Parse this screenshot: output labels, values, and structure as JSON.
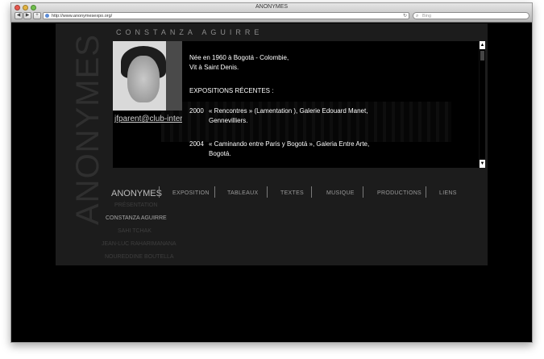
{
  "window": {
    "title": "ANONYMES"
  },
  "browser": {
    "url": "http://www.anonymesexpo.org/",
    "search_placeholder": "Bing",
    "back_label": "◀",
    "forward_label": "▶",
    "add_label": "+"
  },
  "site": {
    "brand": "ANONYMES",
    "vertical_title": "ANONYMES",
    "artist_title": "CONSTANZA AGUIRRE",
    "email": "jfparent@club-internet.fr",
    "bio": [
      "Née en 1960 à Bogotá - Colombie,",
      "Vit à Saint Denis."
    ],
    "expo_heading": "EXPOSITIONS RÉCENTES :",
    "expositions": [
      {
        "year": "2000",
        "text": "« Rencontres » (Lamentation ), Galerie Edouard Manet, Gennevilliers."
      },
      {
        "year": "2004",
        "text": "« Caminando entre Paris y Bogotá », Galeria Entre Arte, Bogotá."
      }
    ],
    "nav": [
      "EXPOSITION",
      "TABLEAUX",
      "TEXTES",
      "MUSIQUE",
      "PRODUCTIONS",
      "LIENS"
    ],
    "subnav": [
      {
        "label": "PRÉSENTATION",
        "active": false
      },
      {
        "label": "CONSTANZA AGUIRRE",
        "active": true
      },
      {
        "label": "SAHI TCHAK",
        "active": false
      },
      {
        "label": "JEAN-LUC RAHARIMANANA",
        "active": false
      },
      {
        "label": "NOUREDDINE BOUTELLA",
        "active": false
      }
    ],
    "scroll_up": "▲",
    "scroll_down": "▼"
  }
}
